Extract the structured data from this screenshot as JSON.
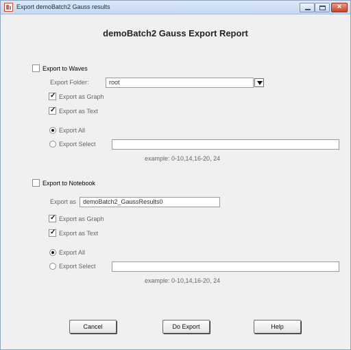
{
  "window": {
    "title": "Export demoBatch2 Gauss results"
  },
  "report_title": "demoBatch2 Gauss Export Report",
  "waves": {
    "checkbox_label": "Export to Waves",
    "folder_label": "Export Folder:",
    "folder_value": "root",
    "graph_label": "Export as Graph",
    "text_label": "Export as Text",
    "export_all_label": "Export All",
    "export_select_label": "Export Select",
    "select_value": "",
    "example": "example: 0-10,14,16-20, 24"
  },
  "notebook": {
    "checkbox_label": "Export to Notebook",
    "export_as_label": "Export as",
    "export_as_value": "demoBatch2_GaussResults0",
    "graph_label": "Export as Graph",
    "text_label": "Export as Text",
    "export_all_label": "Export All",
    "export_select_label": "Export Select",
    "select_value": "",
    "example": "example: 0-10,14,16-20, 24"
  },
  "buttons": {
    "cancel": "Cancel",
    "do_export": "Do Export",
    "help": "Help"
  }
}
